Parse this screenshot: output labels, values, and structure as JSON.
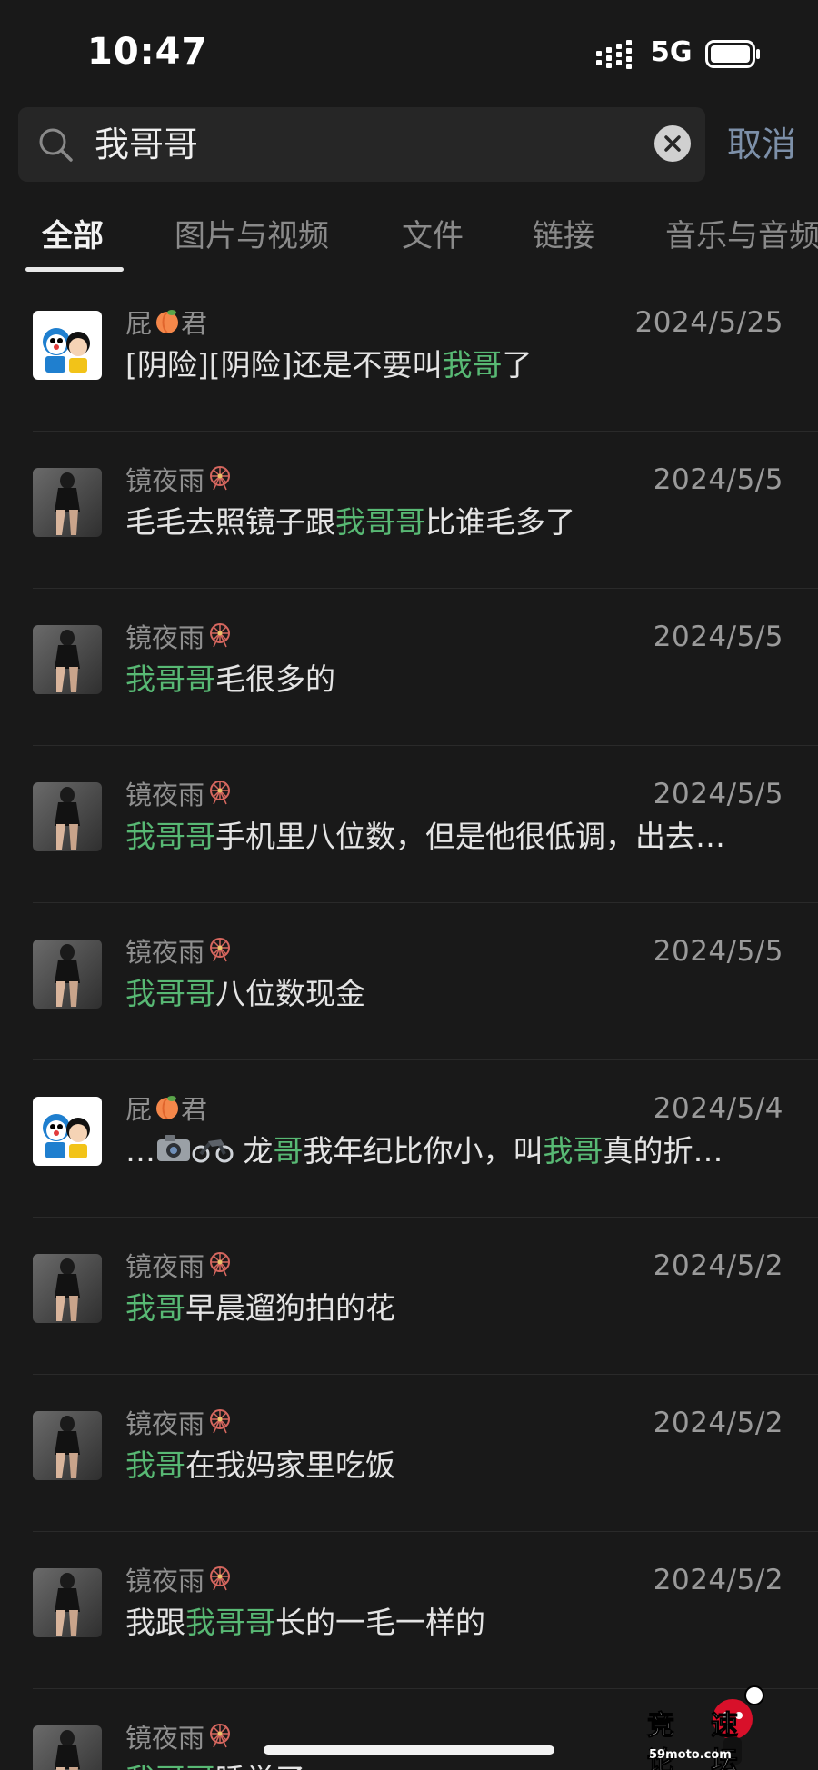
{
  "status_bar": {
    "time": "10:47",
    "network": "5G"
  },
  "search": {
    "query": "我哥哥",
    "cancel_label": "取消"
  },
  "tabs": [
    {
      "label": "全部",
      "active": true
    },
    {
      "label": "图片与视频",
      "active": false
    },
    {
      "label": "文件",
      "active": false
    },
    {
      "label": "链接",
      "active": false
    },
    {
      "label": "音乐与音频",
      "active": false
    }
  ],
  "results": [
    {
      "sender": "屁",
      "sender_suffix": "君",
      "sender_emoji": "peach-icon",
      "avatar": "cartoon-avatar",
      "date": "2024/5/25",
      "message": [
        {
          "t": "[阴险][阴险]还是不要叫"
        },
        {
          "t": "我哥",
          "hl": true
        },
        {
          "t": "了"
        }
      ]
    },
    {
      "sender": "镜夜雨",
      "sender_emoji": "ferris-wheel-icon",
      "avatar": "photo-avatar",
      "date": "2024/5/5",
      "message": [
        {
          "t": "毛毛去照镜子跟"
        },
        {
          "t": "我哥哥",
          "hl": true
        },
        {
          "t": "比谁毛多了"
        }
      ]
    },
    {
      "sender": "镜夜雨",
      "sender_emoji": "ferris-wheel-icon",
      "avatar": "photo-avatar",
      "date": "2024/5/5",
      "message": [
        {
          "t": "我哥哥",
          "hl": true
        },
        {
          "t": "毛很多的"
        }
      ]
    },
    {
      "sender": "镜夜雨",
      "sender_emoji": "ferris-wheel-icon",
      "avatar": "photo-avatar",
      "date": "2024/5/5",
      "message": [
        {
          "t": "我哥哥",
          "hl": true
        },
        {
          "t": "手机里八位数，但是他很低调，出去…"
        }
      ]
    },
    {
      "sender": "镜夜雨",
      "sender_emoji": "ferris-wheel-icon",
      "avatar": "photo-avatar",
      "date": "2024/5/5",
      "message": [
        {
          "t": "我哥哥",
          "hl": true
        },
        {
          "t": "八位数现金"
        }
      ]
    },
    {
      "sender": "屁",
      "sender_suffix": "君",
      "sender_emoji": "peach-icon",
      "avatar": "cartoon-avatar",
      "date": "2024/5/4",
      "message": [
        {
          "t": "…"
        },
        {
          "emoji": "camera-icon"
        },
        {
          "emoji": "motorcycle-icon"
        },
        {
          "t": " 龙"
        },
        {
          "t": "哥",
          "hl": true
        },
        {
          "t": "我年纪比你小，叫"
        },
        {
          "t": "我哥",
          "hl": true
        },
        {
          "t": "真的折…"
        }
      ]
    },
    {
      "sender": "镜夜雨",
      "sender_emoji": "ferris-wheel-icon",
      "avatar": "photo-avatar",
      "date": "2024/5/2",
      "message": [
        {
          "t": "我哥",
          "hl": true
        },
        {
          "t": "早晨遛狗拍的花"
        }
      ]
    },
    {
      "sender": "镜夜雨",
      "sender_emoji": "ferris-wheel-icon",
      "avatar": "photo-avatar",
      "date": "2024/5/2",
      "message": [
        {
          "t": "我哥",
          "hl": true
        },
        {
          "t": "在我妈家里吃饭"
        }
      ]
    },
    {
      "sender": "镜夜雨",
      "sender_emoji": "ferris-wheel-icon",
      "avatar": "photo-avatar",
      "date": "2024/5/2",
      "message": [
        {
          "t": "我跟"
        },
        {
          "t": "我哥哥",
          "hl": true
        },
        {
          "t": "长的一毛一样的"
        }
      ]
    },
    {
      "sender": "镜夜雨",
      "sender_emoji": "ferris-wheel-icon",
      "avatar": "photo-avatar",
      "date": "",
      "message": [
        {
          "t": "我哥哥",
          "hl": true
        },
        {
          "t": "睡觉了"
        }
      ]
    }
  ],
  "watermark": {
    "text": "竞速论坛",
    "sub": "59moto.com"
  },
  "colors": {
    "background": "#191919",
    "highlight": "#58b974",
    "cancel": "#7d90a9"
  }
}
